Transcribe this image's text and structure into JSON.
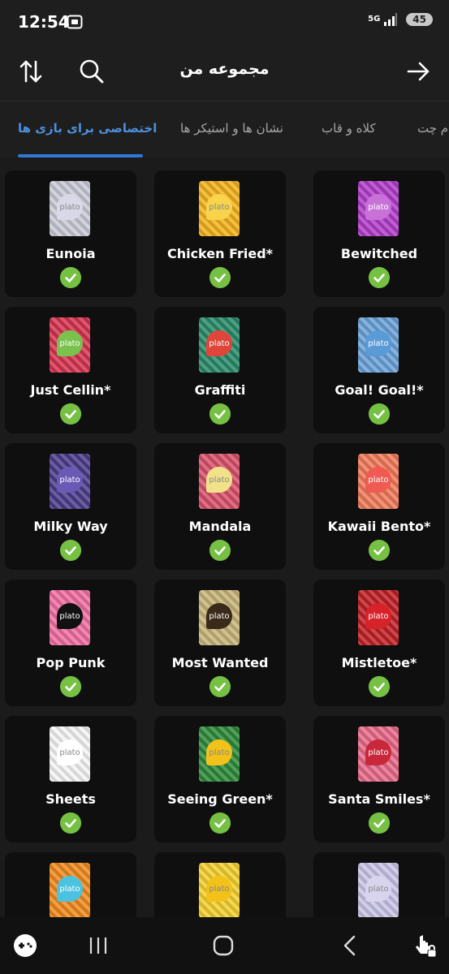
{
  "status": {
    "time": "12:54",
    "network": "5G",
    "battery": "45"
  },
  "app_bar": {
    "title": "مجموعه من",
    "icons": [
      "sort-icon",
      "search-icon",
      "arrow-right-icon"
    ]
  },
  "tabs": [
    {
      "label": "اختصاصی برای بازی ها",
      "active": true
    },
    {
      "label": "نشان ها و استیکر ها",
      "active": false
    },
    {
      "label": "کلاه و قاب",
      "active": false
    },
    {
      "label": "م چت",
      "active": false
    }
  ],
  "brand": "plato",
  "items": [
    {
      "name": "Eunoia",
      "owned": true,
      "color": "#c9c9d6",
      "badge": "#d8d8e8"
    },
    {
      "name": "Chicken Fried*",
      "owned": true,
      "color": "#f2b21c",
      "badge": "#f7d44a"
    },
    {
      "name": "Bewitched",
      "owned": true,
      "color": "#b23cc9",
      "badge": "#c872d8"
    },
    {
      "name": "Just Cellin*",
      "owned": true,
      "color": "#d6334f",
      "badge": "#7ac24e"
    },
    {
      "name": "Graffiti",
      "owned": true,
      "color": "#2a8a6a",
      "badge": "#e0453a"
    },
    {
      "name": "Goal! Goal!*",
      "owned": true,
      "color": "#6aa2d8",
      "badge": "#5a9ad6"
    },
    {
      "name": "Milky Way",
      "owned": true,
      "color": "#4b3c8a",
      "badge": "#6a5ab6"
    },
    {
      "name": "Mandala",
      "owned": true,
      "color": "#d8506a",
      "badge": "#f1e28a"
    },
    {
      "name": "Kawaii Bento*",
      "owned": true,
      "color": "#f07a5a",
      "badge": "#ef5a52"
    },
    {
      "name": "Pop Punk",
      "owned": true,
      "color": "#f06ea2",
      "badge": "#111111"
    },
    {
      "name": "Most Wanted",
      "owned": true,
      "color": "#c8b47a",
      "badge": "#3a2a1a"
    },
    {
      "name": "Mistletoe*",
      "owned": true,
      "color": "#c02025",
      "badge": "#d8222a"
    },
    {
      "name": "Sheets",
      "owned": true,
      "color": "#f4f4f4",
      "badge": "#ffffff"
    },
    {
      "name": "Seeing Green*",
      "owned": true,
      "color": "#2e8a3a",
      "badge": "#f2c21a"
    },
    {
      "name": "Santa Smiles*",
      "owned": true,
      "color": "#e86a8a",
      "badge": "#c8283a"
    },
    {
      "name": "",
      "owned": true,
      "color": "#f08a1c",
      "badge": "#4ac2e0"
    },
    {
      "name": "",
      "owned": true,
      "color": "#f4d030",
      "badge": "#f2c21a"
    },
    {
      "name": "",
      "owned": true,
      "color": "#c8c4e6",
      "badge": "#d8d4ee"
    }
  ],
  "nav": {
    "icons": [
      "game-controller-icon",
      "recent-apps-icon",
      "home-icon",
      "back-icon",
      "touch-lock-icon"
    ]
  },
  "colors": {
    "accent": "#2f78d6",
    "check": "#76c043",
    "card": "#0f0f0f",
    "background": "#1b1b1b"
  }
}
